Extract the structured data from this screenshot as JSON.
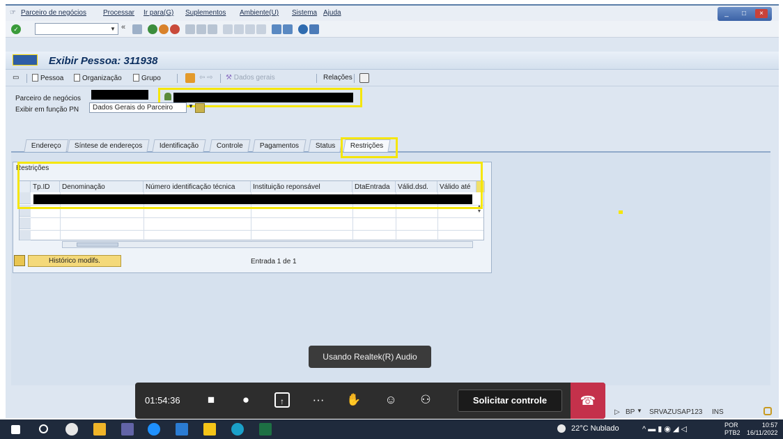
{
  "menu": [
    "Parceiro de negócios",
    "Processar",
    "Ir para(G)",
    "Suplementos",
    "Ambiente(U)",
    "Sistema",
    "Ajuda"
  ],
  "window_buttons": [
    "_",
    "□",
    "×"
  ],
  "command_field": {
    "value": ""
  },
  "page_title": "Exibir Pessoa: 311938",
  "app_toolbar": {
    "pessoa": "Pessoa",
    "organizacao": "Organização",
    "grupo": "Grupo",
    "dados_gerais": "Dados gerais",
    "relacoes": "Relações"
  },
  "form": {
    "partner_label": "Parceiro de negócios",
    "function_label": "Exibir em função PN",
    "function_value": "Dados Gerais do Parceiro"
  },
  "tabs": [
    "Endereço",
    "Síntese de endereços",
    "Identificação",
    "Controle",
    "Pagamentos",
    "Status",
    "Restrições"
  ],
  "active_tab": "Restrições",
  "table": {
    "title": "Restrições",
    "columns": [
      "Tp.ID",
      "Denominação",
      "Número identificação técnica",
      "Instituição reponsável",
      "DtaEntrada",
      "Válid.dsd.",
      "Válido até"
    ]
  },
  "history_button": "Histórico modifs.",
  "entry_count": "Entrada 1 de 1",
  "status_bar": {
    "system": "BP",
    "server": "SRVAZUSAP123",
    "mode": "INS"
  },
  "meeting": {
    "timer": "01:54:36",
    "audio_tooltip": "Usando Realtek(R) Audio",
    "request_control": "Solicitar controle"
  },
  "taskbar": {
    "weather": "22°C Nublado",
    "lang_top": "POR",
    "lang_bottom": "PTB2",
    "time": "10:57",
    "date": "16/11/2022"
  },
  "colors": {
    "highlight": "#f5e60a",
    "hangup": "#c4314b",
    "sap_title": "#0b2e5f"
  }
}
